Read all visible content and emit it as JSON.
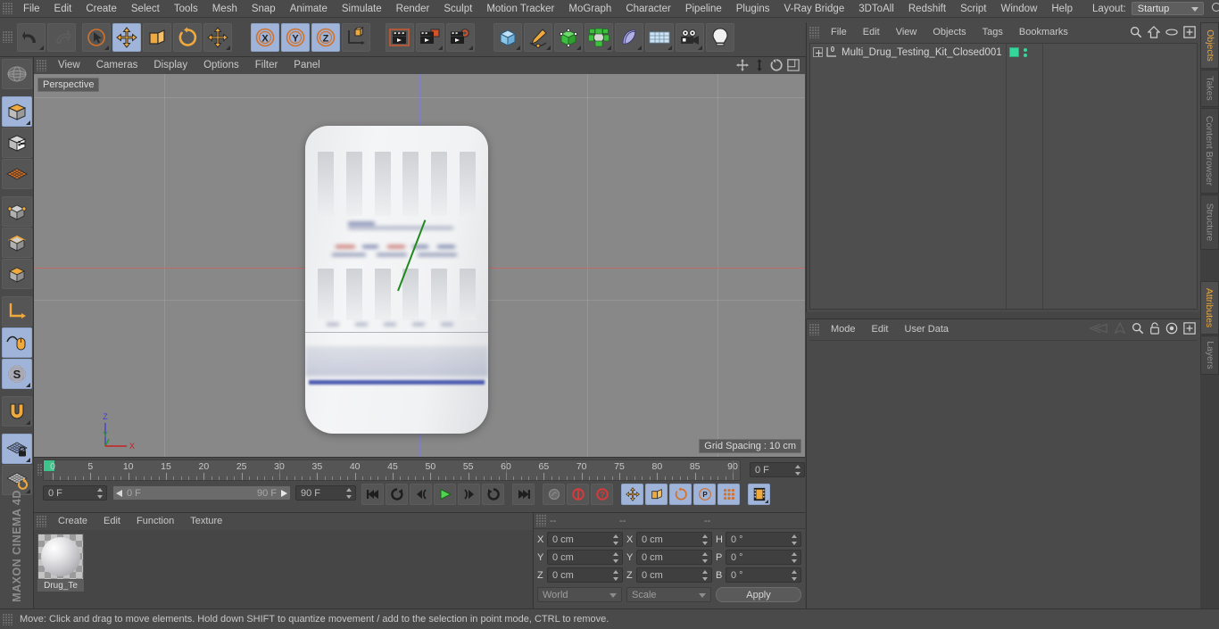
{
  "app": {
    "brand": "MAXON CINEMA 4D"
  },
  "menubar": {
    "items": [
      {
        "label": "File"
      },
      {
        "label": "Edit"
      },
      {
        "label": "Create"
      },
      {
        "label": "Select"
      },
      {
        "label": "Tools"
      },
      {
        "label": "Mesh"
      },
      {
        "label": "Snap"
      },
      {
        "label": "Animate"
      },
      {
        "label": "Simulate"
      },
      {
        "label": "Render"
      },
      {
        "label": "Sculpt"
      },
      {
        "label": "Motion Tracker"
      },
      {
        "label": "MoGraph"
      },
      {
        "label": "Character"
      },
      {
        "label": "Pipeline"
      },
      {
        "label": "Plugins"
      },
      {
        "label": "V-Ray Bridge"
      },
      {
        "label": "3DToAll"
      },
      {
        "label": "Redshift"
      },
      {
        "label": "Script"
      },
      {
        "label": "Window"
      },
      {
        "label": "Help"
      }
    ],
    "layout_label": "Layout:",
    "layout_value": "Startup",
    "search_icon": "search-icon"
  },
  "toolbar": {
    "buttons": [
      {
        "name": "undo-button",
        "icon": "undo-icon",
        "active": false
      },
      {
        "name": "redo-button",
        "icon": "redo-icon",
        "active": false
      },
      {
        "name": "live-selection-button",
        "icon": "cursor-selection-icon",
        "active": false
      },
      {
        "name": "move-tool-button",
        "icon": "move-arrows-icon",
        "active": true
      },
      {
        "name": "scale-tool-button",
        "icon": "scale-box-icon",
        "active": false
      },
      {
        "name": "rotate-tool-button",
        "icon": "rotate-circle-icon",
        "active": false
      },
      {
        "name": "move-alt-button",
        "icon": "move-arrows-icon",
        "active": false
      },
      {
        "name": "lock-x-axis-button",
        "icon": "x-axis-icon",
        "active": true
      },
      {
        "name": "lock-y-axis-button",
        "icon": "y-axis-icon",
        "active": true
      },
      {
        "name": "lock-z-axis-button",
        "icon": "z-axis-icon",
        "active": true
      },
      {
        "name": "world-object-coordinates-button",
        "icon": "world-axis-cube-icon",
        "active": false
      },
      {
        "name": "render-view-button",
        "icon": "render-clapper-icon",
        "active": false
      },
      {
        "name": "render-to-picture-viewer-button",
        "icon": "render-picture-icon",
        "active": false
      },
      {
        "name": "render-settings-button",
        "icon": "render-settings-gear-icon",
        "active": false
      },
      {
        "name": "primitive-cube-button",
        "icon": "cube-icon",
        "active": false
      },
      {
        "name": "spline-pen-button",
        "icon": "pen-spline-icon",
        "active": false
      },
      {
        "name": "nurbs-button",
        "icon": "green-cube-nurbs-icon",
        "active": false
      },
      {
        "name": "array-button",
        "icon": "green-array-icon",
        "active": false
      },
      {
        "name": "bend-deformer-button",
        "icon": "bend-deformer-icon",
        "active": false
      },
      {
        "name": "floor-environment-button",
        "icon": "floor-grid-icon",
        "active": false
      },
      {
        "name": "camera-button",
        "icon": "camera-icon",
        "active": false
      },
      {
        "name": "light-button",
        "icon": "light-bulb-icon",
        "active": false
      }
    ]
  },
  "leftbar": {
    "buttons": [
      {
        "name": "texture-axis-button",
        "icon": "globe-wire-icon",
        "active": false
      },
      {
        "name": "model-mode-button",
        "icon": "model-cube-icon",
        "active": true
      },
      {
        "name": "texture-mode-button",
        "icon": "texture-cube-icon",
        "active": false
      },
      {
        "name": "workplane-mode-button",
        "icon": "workplane-grid-icon",
        "active": false
      },
      {
        "name": "points-mode-button",
        "icon": "points-cube-icon",
        "active": false
      },
      {
        "name": "edges-mode-button",
        "icon": "edges-cube-icon",
        "active": false
      },
      {
        "name": "polygons-mode-button",
        "icon": "polygons-cube-icon",
        "active": false
      },
      {
        "name": "object-axis-button",
        "icon": "axis-l-icon",
        "active": false
      },
      {
        "name": "viewport-solo-button",
        "icon": "mouse-snap-icon",
        "active": true
      },
      {
        "name": "soft-selection-button",
        "icon": "s-sphere-icon",
        "active": true
      },
      {
        "name": "magnet-button",
        "icon": "magnet-icon",
        "active": false
      },
      {
        "name": "workplane-lock-button",
        "icon": "grid-lock-icon",
        "active": true
      },
      {
        "name": "workplane-reset-button",
        "icon": "grid-reset-icon",
        "active": false
      }
    ]
  },
  "viewport": {
    "menu": [
      {
        "label": "View"
      },
      {
        "label": "Cameras"
      },
      {
        "label": "Display"
      },
      {
        "label": "Options"
      },
      {
        "label": "Filter"
      },
      {
        "label": "Panel"
      }
    ],
    "nav_icons": [
      "pan-icon",
      "zoom-icon",
      "rotate-icon",
      "maximize-icon"
    ],
    "perspective_label": "Perspective",
    "grid_spacing": "Grid Spacing : 10 cm",
    "gizmo": {
      "x": "X",
      "y": "Y",
      "z": "Z"
    },
    "model_name": "multi-drug-testing-kit"
  },
  "timeline": {
    "ticks": [
      "0",
      "5",
      "10",
      "15",
      "20",
      "25",
      "30",
      "35",
      "40",
      "45",
      "50",
      "55",
      "60",
      "65",
      "70",
      "75",
      "80",
      "85",
      "90"
    ],
    "current_frame": "0 F",
    "preview_start": "0 F",
    "preview_end": "90 F",
    "end_frame": "90 F",
    "frame_field_right": "0 F",
    "buttons": [
      {
        "name": "go-to-start-button",
        "icon": "skip-start-icon",
        "active": false
      },
      {
        "name": "play-reverse-loop-button",
        "icon": "loop-reverse-icon",
        "active": false
      },
      {
        "name": "previous-key-button",
        "icon": "prev-key-icon",
        "active": false
      },
      {
        "name": "play-button",
        "icon": "play-icon",
        "active": false
      },
      {
        "name": "next-key-button",
        "icon": "next-key-icon",
        "active": false
      },
      {
        "name": "play-forward-loop-button",
        "icon": "loop-forward-icon",
        "active": false
      },
      {
        "name": "go-to-end-button",
        "icon": "skip-end-icon",
        "active": false
      },
      {
        "name": "record-active-objects-button",
        "icon": "record-key-icon",
        "active": false
      },
      {
        "name": "autokeying-button",
        "icon": "autokey-icon",
        "active": false
      },
      {
        "name": "keyframe-selection-button",
        "icon": "question-key-icon",
        "active": false
      },
      {
        "name": "position-key-button",
        "icon": "move-arrows-icon",
        "active": true
      },
      {
        "name": "scale-key-button",
        "icon": "scale-box-icon",
        "active": true
      },
      {
        "name": "rotation-key-button",
        "icon": "rotate-circle-icon",
        "active": true
      },
      {
        "name": "parameter-key-button",
        "icon": "p-circle-icon",
        "active": true
      },
      {
        "name": "point-level-animation-button",
        "icon": "dots-grid-icon",
        "active": true
      },
      {
        "name": "timeline-toggle-button",
        "icon": "filmstrip-icon",
        "active": true
      }
    ]
  },
  "material_manager": {
    "menu": [
      {
        "label": "Create"
      },
      {
        "label": "Edit"
      },
      {
        "label": "Function"
      },
      {
        "label": "Texture"
      }
    ],
    "materials": [
      {
        "name": "Drug_Te",
        "thumb": "sphere-preview"
      }
    ]
  },
  "coordinates": {
    "header": [
      "--",
      "--",
      "--"
    ],
    "position": {
      "x": "0 cm",
      "y": "0 cm",
      "z": "0 cm"
    },
    "size": {
      "x": "0 cm",
      "y": "0 cm",
      "z": "0 cm"
    },
    "rotation": {
      "h": "0 °",
      "p": "0 °",
      "b": "0 °"
    },
    "labels": {
      "px": "X",
      "py": "Y",
      "pz": "Z",
      "sx": "X",
      "sy": "Y",
      "sz": "Z",
      "h": "H",
      "p": "P",
      "b": "B"
    },
    "system": "World",
    "mode": "Scale",
    "apply": "Apply"
  },
  "object_manager": {
    "menu": [
      {
        "label": "File"
      },
      {
        "label": "Edit"
      },
      {
        "label": "View"
      },
      {
        "label": "Objects"
      },
      {
        "label": "Tags"
      },
      {
        "label": "Bookmarks"
      }
    ],
    "icons": [
      "search-icon",
      "home-icon",
      "eye-icon",
      "fit-icon"
    ],
    "objects": [
      {
        "name": "Multi_Drug_Testing_Kit_Closed001",
        "level_badge": "0",
        "tag": "green-material-tag"
      }
    ]
  },
  "attribute_manager": {
    "menu": [
      {
        "label": "Mode"
      },
      {
        "label": "Edit"
      },
      {
        "label": "User Data"
      }
    ],
    "icons": [
      "back-nav-icon",
      "forward-nav-icon",
      "search-icon",
      "lock-icon",
      "target-icon",
      "fit-icon"
    ]
  },
  "right_tabs": {
    "top": [
      {
        "label": "Objects",
        "active": true
      },
      {
        "label": "Takes",
        "active": false
      },
      {
        "label": "Content Browser",
        "active": false
      },
      {
        "label": "Structure",
        "active": false
      }
    ],
    "bottom": [
      {
        "label": "Attributes",
        "active": true
      },
      {
        "label": "Layers",
        "active": false
      }
    ]
  },
  "statusbar": {
    "text": "Move: Click and drag to move elements. Hold down SHIFT to quantize movement / add to the selection in point mode, CTRL to remove."
  },
  "colors": {
    "panel": "#4a4a4a",
    "viewport": "#888888",
    "accent_orange": "#e8a53c",
    "active_blue": "#9fb4d8",
    "green_tag": "#35d69a",
    "axis_x": "#c06a6a",
    "axis_z": "#7f7fc4"
  }
}
